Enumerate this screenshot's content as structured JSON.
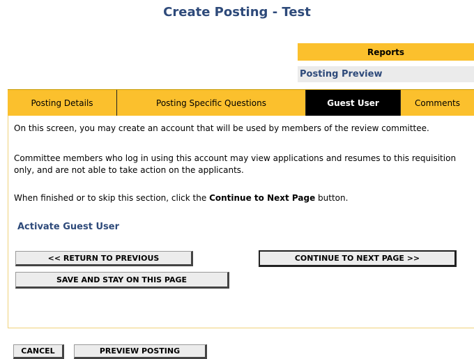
{
  "page": {
    "title": "Create Posting - Test"
  },
  "reports": {
    "header": "Reports",
    "items": [
      "Posting Preview"
    ]
  },
  "tabs": [
    {
      "label": "Posting Details",
      "active": false
    },
    {
      "label": "Posting Specific Questions",
      "active": false
    },
    {
      "label": "Guest User",
      "active": true
    },
    {
      "label": "Comments",
      "active": false
    }
  ],
  "content": {
    "intro": "On this screen, you may create an account that will be used by members of the review committee.",
    "committee_note": "Committee members who log in using this account may view applications and resumes to this requisition only, and are not able to take action on the applicants.",
    "finish_note_prefix": "When finished or to skip this section, click the ",
    "finish_note_bold": "Continue to Next Page",
    "finish_note_suffix": " button.",
    "activate_link": "Activate Guest User"
  },
  "buttons": {
    "return_previous": "<< RETURN TO PREVIOUS",
    "continue_next": "CONTINUE TO NEXT PAGE >>",
    "save_stay": "SAVE AND STAY ON THIS PAGE",
    "cancel": "CANCEL",
    "preview_posting": "PREVIEW POSTING"
  },
  "colors": {
    "accent": "#fbc02d",
    "link": "#2e4a7a",
    "active_tab": "#000000"
  }
}
